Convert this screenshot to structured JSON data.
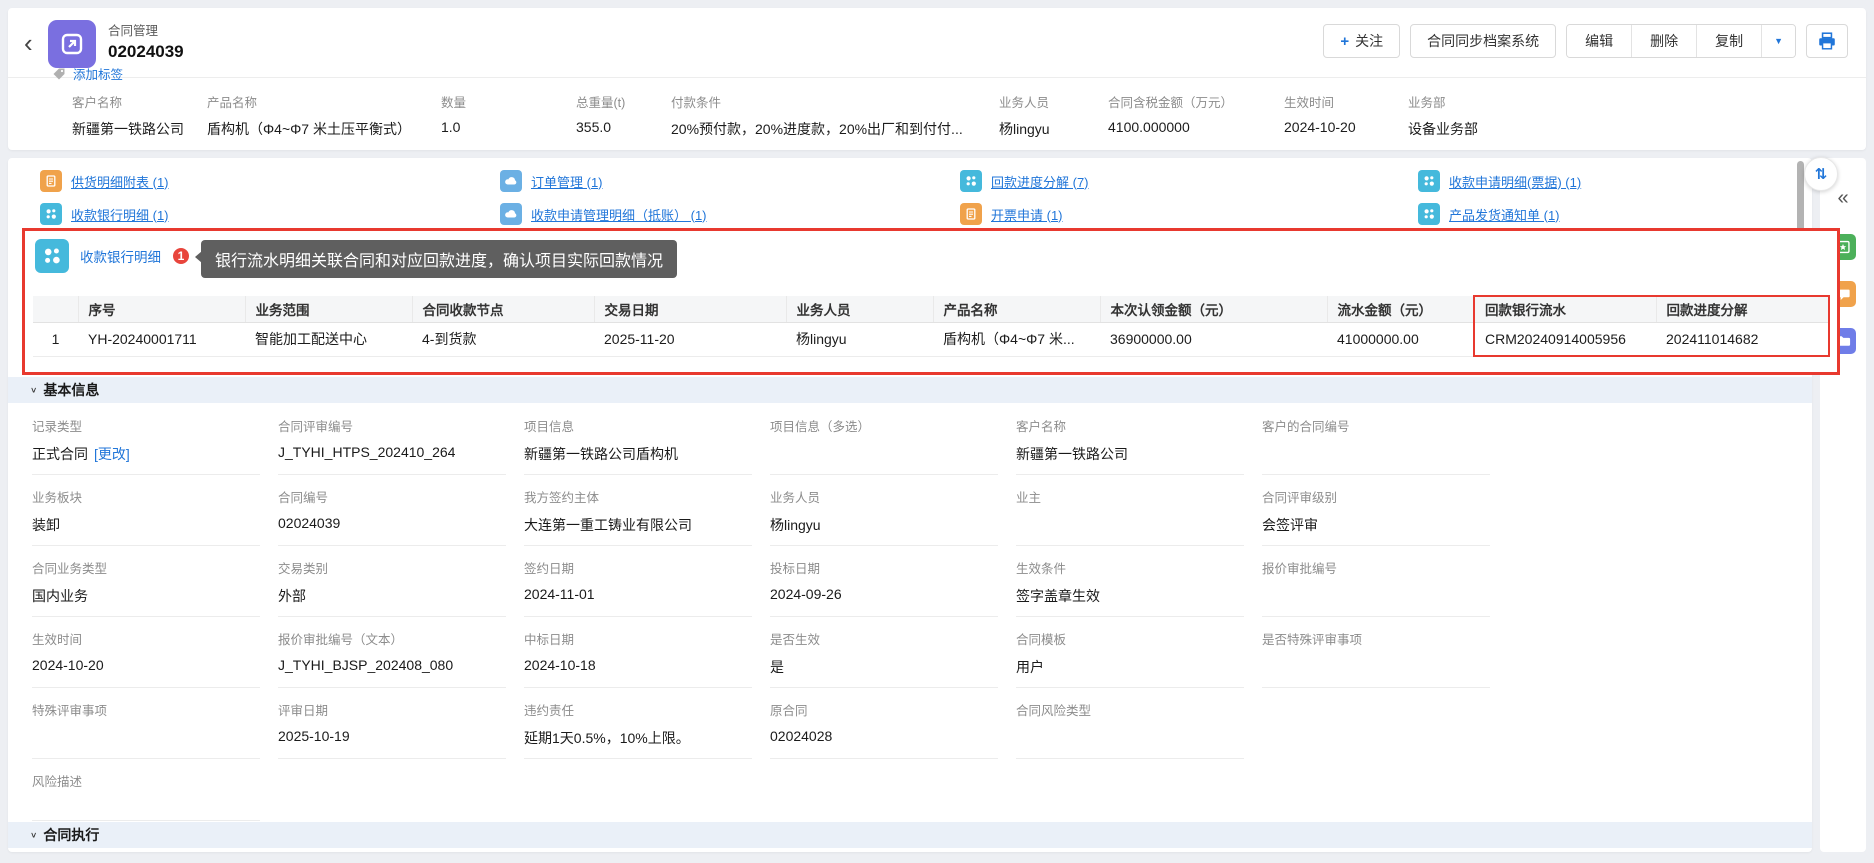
{
  "icons": {
    "back": "‹",
    "collapse": "«",
    "swap": "⇅",
    "dropdown": "▼",
    "caret": "∨",
    "plus": "+"
  },
  "colors": {
    "accent_blue": "#2176d9",
    "highlight_red": "#e8392f",
    "icon_purple": "#7a6fe0",
    "icon_cyan": "#45b9dc",
    "icon_orange": "#f0a24b",
    "icon_blue": "#6bb0e4",
    "rail_green": "#4cb05a",
    "rail_orange": "#f0a24b",
    "rail_violet": "#6f7de8",
    "tooltip_bg": "#5f5f5f"
  },
  "header": {
    "object_type": "合同管理",
    "record_number": "02024039",
    "add_tag_label": "添加标签",
    "buttons": {
      "follow": "关注",
      "sync_archive": "合同同步档案系统",
      "edit": "编辑",
      "delete": "删除",
      "copy": "复制"
    }
  },
  "summary_bar": {
    "fields": [
      {
        "label": "客户名称",
        "value": "新疆第一铁路公司"
      },
      {
        "label": "产品名称",
        "value": "盾构机（Φ4~Φ7 米土压平衡式）"
      },
      {
        "label": "数量",
        "value": "1.0"
      },
      {
        "label": "总重量(t)",
        "value": "355.0"
      },
      {
        "label": "付款条件",
        "value": "20%预付款，20%进度款，20%出厂和到付付..."
      },
      {
        "label": "业务人员",
        "value": "杨lingyu"
      },
      {
        "label": "合同含税金额（万元）",
        "value": "4100.000000"
      },
      {
        "label": "生效时间",
        "value": "2024-10-20"
      },
      {
        "label": "业务部",
        "value": "设备业务部"
      }
    ]
  },
  "related_links": [
    {
      "label": "供货明细附表 (1)",
      "icon": "receipt-icon"
    },
    {
      "label": "订单管理 (1)",
      "icon": "cloud-icon"
    },
    {
      "label": "回款进度分解 (7)",
      "icon": "molecule-icon"
    },
    {
      "label": "收款申请明细(票据) (1)",
      "icon": "molecule-icon"
    },
    {
      "label": "收款银行明细 (1)",
      "icon": "molecule-icon"
    },
    {
      "label": "收款申请管理明细（抵账） (1)",
      "icon": "cloud-icon"
    },
    {
      "label": "开票申请 (1)",
      "icon": "receipt-icon"
    },
    {
      "label": "产品发货通知单 (1)",
      "icon": "molecule-icon"
    }
  ],
  "bank_flow_section": {
    "title": "收款银行明细",
    "badge": "1",
    "tooltip": "银行流水明细关联合同和对应回款进度，确认项目实际回款情况",
    "table": {
      "headers": [
        "序号",
        "业务范围",
        "合同收款节点",
        "交易日期",
        "业务人员",
        "产品名称",
        "本次认领金额（元）",
        "流水金额（元）",
        "回款银行流水",
        "回款进度分解"
      ],
      "rows": [
        {
          "cells": [
            "1",
            "YH-20240001711",
            "智能加工配送中心",
            "4-到货款",
            "2025-11-20",
            "杨lingyu",
            "盾构机（Φ4~Φ7 米...",
            "36900000.00",
            "41000000.00",
            "CRM20240914005956",
            "202411014682"
          ]
        }
      ]
    }
  },
  "basic_info": {
    "title": "基本信息",
    "fields": [
      {
        "label": "记录类型",
        "value": "正式合同",
        "extra": "[更改]"
      },
      {
        "label": "合同评审编号",
        "value": "J_TYHI_HTPS_202410_264"
      },
      {
        "label": "项目信息",
        "value": "新疆第一铁路公司盾构机"
      },
      {
        "label": "项目信息（多选）",
        "value": ""
      },
      {
        "label": "客户名称",
        "value": "新疆第一铁路公司"
      },
      {
        "label": "客户的合同编号",
        "value": ""
      },
      {
        "label": "业务板块",
        "value": "装卸"
      },
      {
        "label": "合同编号",
        "value": "02024039"
      },
      {
        "label": "我方签约主体",
        "value": "大连第一重工铸业有限公司"
      },
      {
        "label": "业务人员",
        "value": "杨lingyu"
      },
      {
        "label": "业主",
        "value": ""
      },
      {
        "label": "合同评审级别",
        "value": "会签评审"
      },
      {
        "label": "合同业务类型",
        "value": "国内业务"
      },
      {
        "label": "交易类别",
        "value": "外部"
      },
      {
        "label": "签约日期",
        "value": "2024-11-01"
      },
      {
        "label": "投标日期",
        "value": "2024-09-26"
      },
      {
        "label": "生效条件",
        "value": "签字盖章生效"
      },
      {
        "label": "报价审批编号",
        "value": ""
      },
      {
        "label": "生效时间",
        "value": "2024-10-20"
      },
      {
        "label": "报价审批编号（文本）",
        "value": "J_TYHI_BJSP_202408_080"
      },
      {
        "label": "中标日期",
        "value": "2024-10-18"
      },
      {
        "label": "是否生效",
        "value": "是"
      },
      {
        "label": "合同模板",
        "value": "用户"
      },
      {
        "label": "是否特殊评审事项",
        "value": ""
      },
      {
        "label": "特殊评审事项",
        "value": ""
      },
      {
        "label": "评审日期",
        "value": "2025-10-19"
      },
      {
        "label": "违约责任",
        "value": "延期1天0.5%，10%上限。"
      },
      {
        "label": "原合同",
        "value": "02024028"
      },
      {
        "label": "合同风险类型",
        "value": ""
      },
      {
        "label": "风险描述",
        "value": ""
      }
    ]
  },
  "contract_exec_section": {
    "title": "合同执行"
  }
}
